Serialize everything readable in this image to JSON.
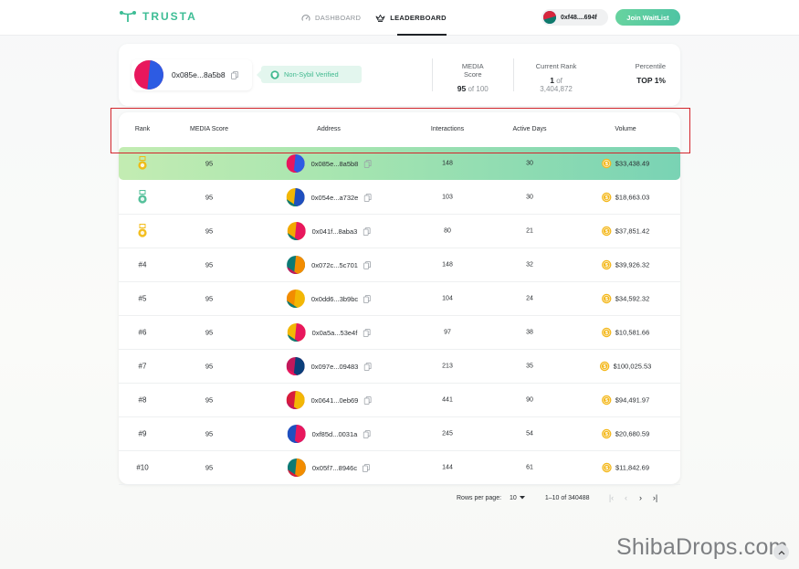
{
  "nav": {
    "brand": "TRUSTA",
    "dashboard": "DASHBOARD",
    "leaderboard": "LEADERBOARD",
    "wallet": "0xf48....694f",
    "join": "Join WaitList"
  },
  "profile": {
    "address": "0x085e...8a5b8",
    "badge": "Non-Sybil Verified",
    "media_label": "MEDIA Score",
    "media_value": "95",
    "media_total": "of 100",
    "rank_label": "Current Rank",
    "rank_value": "1",
    "rank_total": "of 3,404,872",
    "percentile_label": "Percentile",
    "percentile_value": "TOP 1%"
  },
  "table": {
    "headers": {
      "rank": "Rank",
      "media": "MEDIA Score",
      "address": "Address",
      "interactions": "Interactions",
      "active_days": "Active Days",
      "volume": "Volume"
    },
    "rows": [
      {
        "rank": "",
        "medal": "gold",
        "score": "95",
        "address": "0x085e...8a5b8",
        "interactions": "148",
        "days": "30",
        "volume": "$33,438.49"
      },
      {
        "rank": "",
        "medal": "silver",
        "score": "95",
        "address": "0x054e...a732e",
        "interactions": "103",
        "days": "30",
        "volume": "$18,663.03"
      },
      {
        "rank": "",
        "medal": "bronze",
        "score": "95",
        "address": "0x041f...8aba3",
        "interactions": "80",
        "days": "21",
        "volume": "$37,851.42"
      },
      {
        "rank": "#4",
        "score": "95",
        "address": "0x072c...5c701",
        "interactions": "148",
        "days": "32",
        "volume": "$39,926.32"
      },
      {
        "rank": "#5",
        "score": "95",
        "address": "0x0dd6...3b9bc",
        "interactions": "104",
        "days": "24",
        "volume": "$34,592.32"
      },
      {
        "rank": "#6",
        "score": "95",
        "address": "0x0a5a...53e4f",
        "interactions": "97",
        "days": "38",
        "volume": "$10,581.66"
      },
      {
        "rank": "#7",
        "score": "95",
        "address": "0x097e...09483",
        "interactions": "213",
        "days": "35",
        "volume": "$100,025.53"
      },
      {
        "rank": "#8",
        "score": "95",
        "address": "0x0641...0eb69",
        "interactions": "441",
        "days": "90",
        "volume": "$94,491.97"
      },
      {
        "rank": "#9",
        "score": "95",
        "address": "0xf85d...0031a",
        "interactions": "245",
        "days": "54",
        "volume": "$20,680.59"
      },
      {
        "rank": "#10",
        "score": "95",
        "address": "0x05f7...8946c",
        "interactions": "144",
        "days": "61",
        "volume": "$11,842.69"
      }
    ]
  },
  "pagination": {
    "rows_per_page_label": "Rows per page:",
    "rows_per_page": "10",
    "range": "1–10 of 340488",
    "first": "|‹",
    "prev": "‹",
    "next": "›",
    "last": "›|"
  },
  "watermark": "ShibaDrops.com",
  "colors": {
    "accent": "#3dbd95",
    "highlight_box": "#d3242b",
    "first_row_start": "#c3ecb2",
    "first_row_end": "#79d3b4",
    "coin": "#f4b81c"
  },
  "icons": {
    "logo": "trusta-logo-icon",
    "dashboard": "gauge-icon",
    "leaderboard": "crown-icon",
    "copy": "copy-icon",
    "verified": "shield-check-icon",
    "coin": "coin-icon",
    "dropdown": "caret-down-icon",
    "scroll_top": "chevron-up-icon"
  }
}
